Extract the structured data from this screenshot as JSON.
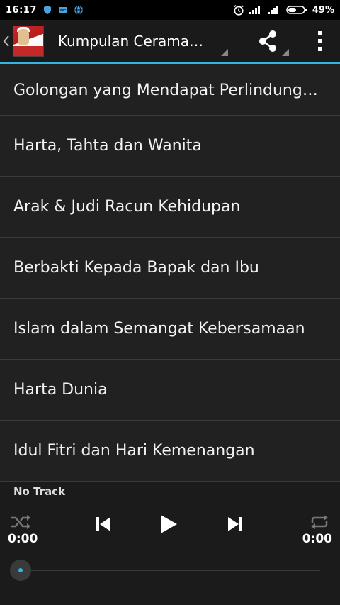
{
  "status_bar": {
    "time": "16:17",
    "battery": "49%"
  },
  "action_bar": {
    "title": "Kumpulan Ceramah.."
  },
  "lectures": [
    "Golongan yang Mendapat Perlindungan",
    "Harta, Tahta dan Wanita",
    "Arak & Judi Racun Kehidupan",
    "Berbakti Kepada Bapak dan Ibu",
    "Islam dalam Semangat Kebersamaan",
    "Harta Dunia",
    "Idul Fitri dan Hari Kemenangan"
  ],
  "player": {
    "track": "No Track",
    "elapsed": "0:00",
    "duration": "0:00",
    "progress": 0
  },
  "colors": {
    "accent": "#33b5e5",
    "background": "#212121"
  }
}
